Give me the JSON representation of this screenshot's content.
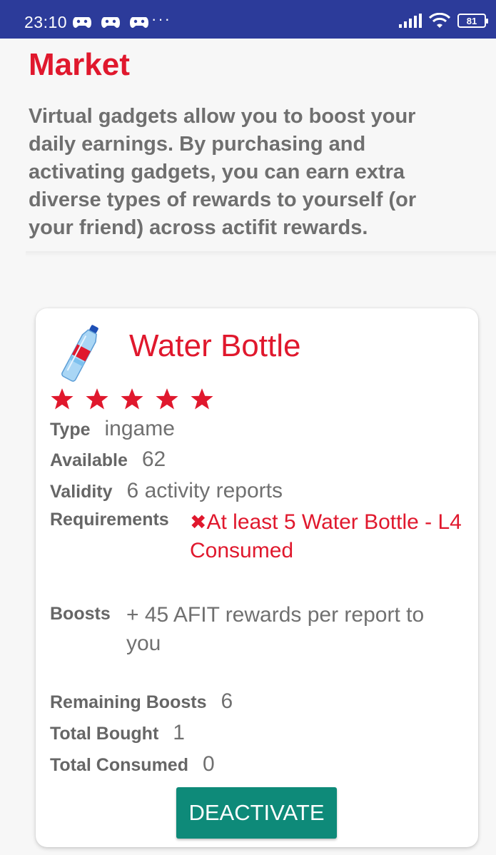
{
  "status_bar": {
    "time": "23:10",
    "dots": "···",
    "battery": "81"
  },
  "market": {
    "title": "Market",
    "intro": "Virtual gadgets allow you to boost your daily earnings. By purchasing and activating gadgets, you can earn extra diverse types of rewards to yourself (or your friend) across actifit rewards."
  },
  "gadget": {
    "name": "Water Bottle",
    "rating": 5,
    "rating_max": 5,
    "type_label": "Type",
    "type_value": "ingame",
    "available_label": "Available",
    "available_value": "62",
    "validity_label": "Validity",
    "validity_value": "6 activity reports",
    "requirements_label": "Requirements",
    "requirements_value": "At least 5 Water Bottle - L4 Consumed",
    "boosts_label": "Boosts",
    "boosts_value": "+ 45 AFIT rewards per report to you",
    "remaining_label": "Remaining Boosts",
    "remaining_value": "6",
    "bought_label": "Total Bought",
    "bought_value": "1",
    "consumed_label": "Total Consumed",
    "consumed_value": "0",
    "action_label": "DEACTIVATE"
  },
  "colors": {
    "accent_red": "#e0182d",
    "button_teal": "#0e8a79",
    "status_bar": "#2c3b9a"
  }
}
